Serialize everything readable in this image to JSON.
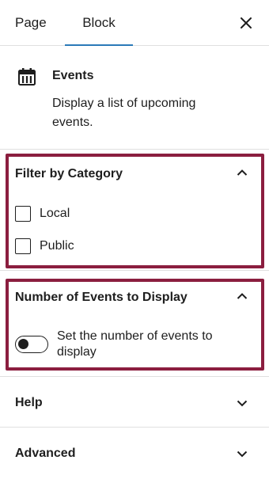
{
  "tabs": [
    {
      "label": "Page"
    },
    {
      "label": "Block"
    }
  ],
  "close_icon": "close-icon",
  "accent_color": "#2b7ab8",
  "highlight_color": "#8b1e3f",
  "block": {
    "icon": "calendar-icon",
    "title": "Events",
    "description": "Display a list of upcoming events."
  },
  "panels": {
    "filter": {
      "title": "Filter by Category",
      "expanded": true,
      "options": [
        {
          "label": "Local",
          "checked": false
        },
        {
          "label": "Public",
          "checked": false
        }
      ]
    },
    "number": {
      "title": "Number of Events to Display",
      "expanded": true,
      "toggle_label": "Set the number of events to display",
      "toggle_on": false
    },
    "help": {
      "title": "Help",
      "expanded": false
    },
    "advanced": {
      "title": "Advanced",
      "expanded": false
    }
  }
}
